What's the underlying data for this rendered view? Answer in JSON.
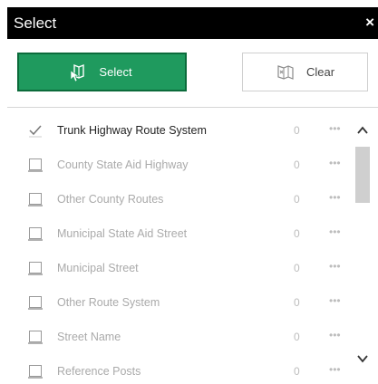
{
  "panel": {
    "title": "Select",
    "close_symbol": "×"
  },
  "buttons": {
    "select": {
      "label": "Select",
      "icon": "select-map-icon"
    },
    "clear": {
      "label": "Clear",
      "icon": "clear-map-icon"
    }
  },
  "layers": [
    {
      "label": "Trunk Highway Route System",
      "count": "0",
      "checked": true,
      "active": true
    },
    {
      "label": "County State Aid Highway",
      "count": "0",
      "checked": false,
      "active": false
    },
    {
      "label": "Other County Routes",
      "count": "0",
      "checked": false,
      "active": false
    },
    {
      "label": "Municipal State Aid Street",
      "count": "0",
      "checked": false,
      "active": false
    },
    {
      "label": "Municipal Street",
      "count": "0",
      "checked": false,
      "active": false
    },
    {
      "label": "Other Route System",
      "count": "0",
      "checked": false,
      "active": false
    },
    {
      "label": "Street Name",
      "count": "0",
      "checked": false,
      "active": false
    },
    {
      "label": "Reference Posts",
      "count": "0",
      "checked": false,
      "active": false
    }
  ],
  "row_menu_symbol": "•••",
  "colors": {
    "select_button": "#1f9a5e",
    "title_bar": "#000000"
  }
}
